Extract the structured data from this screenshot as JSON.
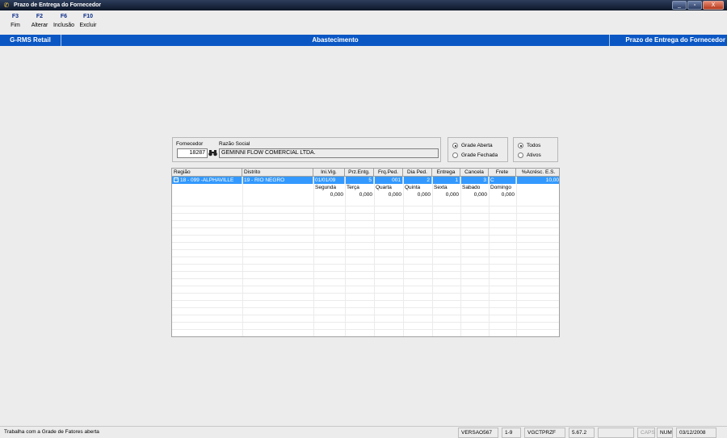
{
  "window": {
    "title": "Prazo de Entrega do Fornecedor",
    "buttons": [
      "_",
      "▫",
      "X"
    ]
  },
  "toolbar": [
    {
      "key": "F3",
      "label": "Fim"
    },
    {
      "key": "F2",
      "label": "Alterar"
    },
    {
      "key": "F6",
      "label": "Inclusão"
    },
    {
      "key": "F10",
      "label": "Excluir"
    }
  ],
  "header": {
    "left": "G-RMS Retail",
    "center": "Abastecimento",
    "right": "Prazo de Entrega do Fornecedor",
    "color": "#0a57c4"
  },
  "supplier": {
    "code_label": "Fornecedor",
    "name_label": "Razão Social",
    "code": "18287",
    "name": "GEMINNI FLOW COMERCIAL LTDA."
  },
  "grade_filter": {
    "options": [
      "Grade Aberta",
      "Grade Fechada"
    ],
    "selected": "Grade Aberta"
  },
  "status_filter": {
    "options": [
      "Todos",
      "Ativos"
    ],
    "selected": "Todos"
  },
  "grid": {
    "columns": [
      "Região",
      "Distrito",
      "Ini.Vig.",
      "Prz.Entg.",
      "Frq.Ped.",
      "Dia Ped.",
      "Entrega",
      "Cancela",
      "Frete",
      "%Acrésc. E.S."
    ],
    "rows": [
      {
        "regiao": "18 - 099 -ALPHAVILLE",
        "distrito": "19 - RIO NEGRO",
        "ini_vig": "01/01/09",
        "prz_entg": "5",
        "frq_ped": "001",
        "dia_ped": "2",
        "entrega": "1",
        "cancela": "3",
        "frete": "C",
        "acresc": "10,00",
        "selected": true
      }
    ],
    "sub_columns": [
      "Segunda",
      "Terça",
      "Quarta",
      "Quinta",
      "Sexta",
      "Sabado",
      "Domingo"
    ],
    "sub_values": [
      "0,000",
      "0,000",
      "0,000",
      "0,000",
      "0,000",
      "0,000",
      "0,000"
    ]
  },
  "statusbar": {
    "message": "Trabalha com a Grade de Fatores aberta",
    "version": "VERSAO567",
    "range": "1-9",
    "program": "VGCTPRZF",
    "build": "5.67.2",
    "caps": "CAPS",
    "num": "NUM",
    "date": "03/12/2008"
  }
}
